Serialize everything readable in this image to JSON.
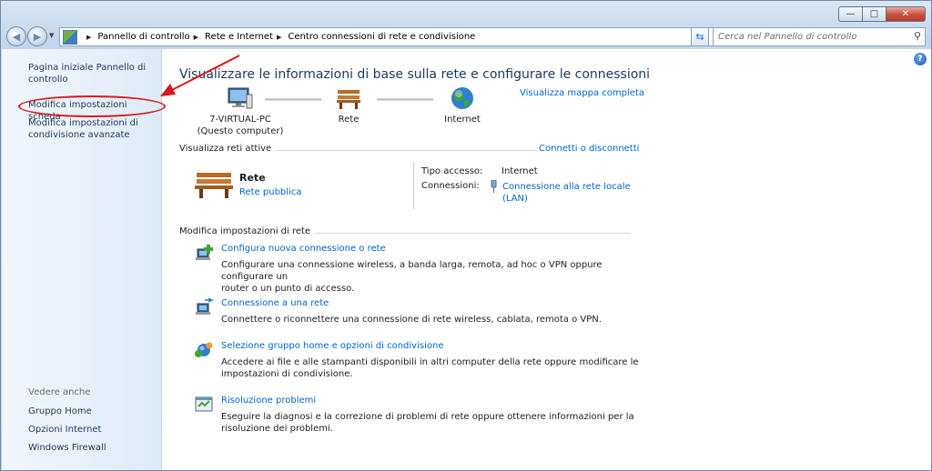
{
  "window": {
    "caption_buttons": {
      "minimize": "—",
      "maximize": "□",
      "close": "✕"
    }
  },
  "navigation": {
    "back_icon": "back-arrow-icon",
    "forward_icon": "forward-arrow-icon",
    "breadcrumb": [
      "Pannello di controllo",
      "Rete e Internet",
      "Centro connessioni di rete e condivisione"
    ],
    "search_placeholder": "Cerca nel Pannello di controllo"
  },
  "sidebar": {
    "links": [
      {
        "label_line1": "Pagina iniziale Pannello di",
        "label_line2": "controllo"
      },
      {
        "label_line1": "Modifica impostazioni scheda",
        "label_line2": ""
      },
      {
        "label_line1": "Modifica impostazioni di",
        "label_line2": "condivisione avanzate"
      }
    ],
    "see_also_title": "Vedere anche",
    "see_also": [
      "Gruppo Home",
      "Opzioni Internet",
      "Windows Firewall"
    ]
  },
  "main": {
    "title": "Visualizzare le informazioni di base sulla rete e configurare le connessioni",
    "full_map_link": "Visualizza mappa completa",
    "map": {
      "computer_name": "7-VIRTUAL-PC",
      "computer_note": "(Questo computer)",
      "network_label": "Rete",
      "internet_label": "Internet"
    },
    "active_networks": {
      "heading": "Visualizza reti attive",
      "connect_link": "Connetti o disconnetti",
      "network_name": "Rete",
      "network_type": "Rete pubblica",
      "access_type_label": "Tipo accesso:",
      "access_type_value": "Internet",
      "connections_label": "Connessioni:",
      "connection_line1": "Connessione alla rete locale",
      "connection_line2": "(LAN)"
    },
    "change_settings": {
      "heading": "Modifica impostazioni di rete",
      "tasks": [
        {
          "title": "Configura nuova connessione o rete",
          "desc_line1": "Configurare una connessione wireless, a banda larga, remota, ad hoc o VPN oppure configurare un",
          "desc_line2": "router o un punto di accesso.",
          "icon": "new-connection-icon"
        },
        {
          "title": "Connessione a una rete",
          "desc_line1": "Connettere o riconnettere una connessione di rete wireless, cablata, remota o VPN.",
          "desc_line2": "",
          "icon": "connect-network-icon"
        },
        {
          "title": "Selezione gruppo home e opzioni di condivisione",
          "desc_line1": "Accedere ai file e alle stampanti disponibili in altri computer della rete oppure modificare le",
          "desc_line2": "impostazioni di condivisione.",
          "icon": "homegroup-icon"
        },
        {
          "title": "Risoluzione problemi",
          "desc_line1": "Eseguire la diagnosi e la correzione di problemi di rete oppure ottenere informazioni per la",
          "desc_line2": "risoluzione dei problemi.",
          "icon": "troubleshoot-icon"
        }
      ]
    }
  },
  "colors": {
    "link": "#0066cc",
    "title": "#1e395b",
    "annotation": "#d7191c"
  }
}
